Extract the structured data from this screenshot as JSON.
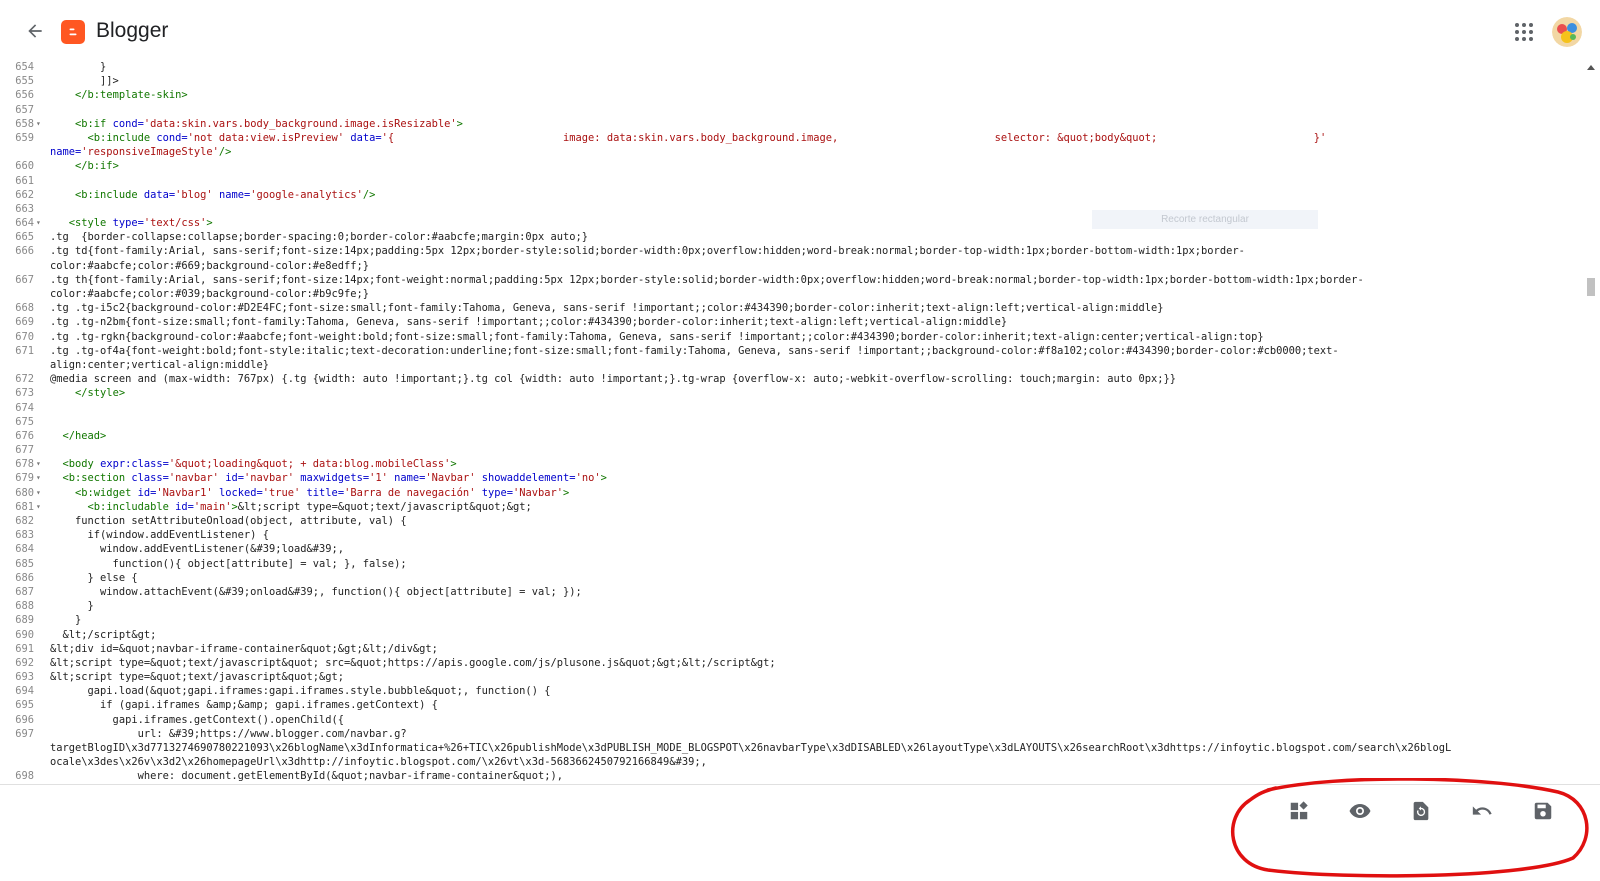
{
  "header": {
    "title": "Blogger",
    "back_icon": "arrow-left-icon",
    "apps_icon": "apps-grid-icon",
    "avatar_icon": "user-avatar"
  },
  "colors": {
    "brand": "#ff5722",
    "tag": "#117700",
    "attribute": "#0000cc",
    "string": "#aa1111",
    "annotation": "#e01010"
  },
  "editor": {
    "lines": [
      {
        "n": "654",
        "fold": "",
        "segs": [
          {
            "t": "        }"
          }
        ]
      },
      {
        "n": "655",
        "fold": "",
        "segs": [
          {
            "t": "        ]]>"
          }
        ]
      },
      {
        "n": "656",
        "fold": "",
        "segs": [
          {
            "t": "    ",
            "c": ""
          },
          {
            "t": "</b:template-skin>",
            "c": "tag"
          }
        ]
      },
      {
        "n": "657",
        "fold": "",
        "segs": [
          {
            "t": ""
          }
        ]
      },
      {
        "n": "658",
        "fold": "▾",
        "segs": [
          {
            "t": "    "
          },
          {
            "t": "<b:if ",
            "c": "tag"
          },
          {
            "t": "cond=",
            "c": "attr"
          },
          {
            "t": "'data:skin.vars.body_background.image.isResizable'",
            "c": "str"
          },
          {
            "t": ">",
            "c": "tag"
          }
        ]
      },
      {
        "n": "659",
        "fold": "",
        "segs": [
          {
            "t": "      "
          },
          {
            "t": "<b:include ",
            "c": "tag"
          },
          {
            "t": "cond=",
            "c": "attr"
          },
          {
            "t": "'not data:view.isPreview'",
            "c": "str"
          },
          {
            "t": " data=",
            "c": "attr"
          },
          {
            "t": "'{                           image: data:skin.vars.body_background.image,                         selector: &quot;body&quot;                         }'",
            "c": "str"
          }
        ]
      },
      {
        "n": "",
        "fold": "",
        "segs": [
          {
            "t": "name=",
            "c": "attr"
          },
          {
            "t": "'responsiveImageStyle'",
            "c": "str"
          },
          {
            "t": "/>",
            "c": "tag"
          }
        ]
      },
      {
        "n": "660",
        "fold": "",
        "segs": [
          {
            "t": "    "
          },
          {
            "t": "</b:if>",
            "c": "tag"
          }
        ]
      },
      {
        "n": "661",
        "fold": "",
        "segs": [
          {
            "t": ""
          }
        ]
      },
      {
        "n": "662",
        "fold": "",
        "segs": [
          {
            "t": "    "
          },
          {
            "t": "<b:include ",
            "c": "tag"
          },
          {
            "t": "data=",
            "c": "attr"
          },
          {
            "t": "'blog'",
            "c": "str"
          },
          {
            "t": " name=",
            "c": "attr"
          },
          {
            "t": "'google-analytics'",
            "c": "str"
          },
          {
            "t": "/>",
            "c": "tag"
          }
        ]
      },
      {
        "n": "663",
        "fold": "",
        "segs": [
          {
            "t": ""
          }
        ]
      },
      {
        "n": "664",
        "fold": "▾",
        "segs": [
          {
            "t": "   "
          },
          {
            "t": "<style ",
            "c": "tag"
          },
          {
            "t": "type=",
            "c": "attr"
          },
          {
            "t": "'text/css'",
            "c": "str"
          },
          {
            "t": ">",
            "c": "tag"
          }
        ]
      },
      {
        "n": "665",
        "fold": "",
        "segs": [
          {
            "t": ".tg  {border-collapse:collapse;border-spacing:0;border-color:#aabcfe;margin:0px auto;}"
          }
        ]
      },
      {
        "n": "666",
        "fold": "",
        "segs": [
          {
            "t": ".tg td{font-family:Arial, sans-serif;font-size:14px;padding:5px 12px;border-style:solid;border-width:0px;overflow:hidden;word-break:normal;border-top-width:1px;border-bottom-width:1px;border-"
          }
        ]
      },
      {
        "n": "",
        "fold": "",
        "segs": [
          {
            "t": "color:#aabcfe;color:#669;background-color:#e8edff;}"
          }
        ]
      },
      {
        "n": "667",
        "fold": "",
        "segs": [
          {
            "t": ".tg th{font-family:Arial, sans-serif;font-size:14px;font-weight:normal;padding:5px 12px;border-style:solid;border-width:0px;overflow:hidden;word-break:normal;border-top-width:1px;border-bottom-width:1px;border-"
          }
        ]
      },
      {
        "n": "",
        "fold": "",
        "segs": [
          {
            "t": "color:#aabcfe;color:#039;background-color:#b9c9fe;}"
          }
        ]
      },
      {
        "n": "668",
        "fold": "",
        "segs": [
          {
            "t": ".tg .tg-i5c2{background-color:#D2E4FC;font-size:small;font-family:Tahoma, Geneva, sans-serif !important;;color:#434390;border-color:inherit;text-align:left;vertical-align:middle}"
          }
        ]
      },
      {
        "n": "669",
        "fold": "",
        "segs": [
          {
            "t": ".tg .tg-n2bm{font-size:small;font-family:Tahoma, Geneva, sans-serif !important;;color:#434390;border-color:inherit;text-align:left;vertical-align:middle}"
          }
        ]
      },
      {
        "n": "670",
        "fold": "",
        "segs": [
          {
            "t": ".tg .tg-rgkn{background-color:#aabcfe;font-weight:bold;font-size:small;font-family:Tahoma, Geneva, sans-serif !important;;color:#434390;border-color:inherit;text-align:center;vertical-align:top}"
          }
        ]
      },
      {
        "n": "671",
        "fold": "",
        "segs": [
          {
            "t": ".tg .tg-of4a{font-weight:bold;font-style:italic;text-decoration:underline;font-size:small;font-family:Tahoma, Geneva, sans-serif !important;;background-color:#f8a102;color:#434390;border-color:#cb0000;text-"
          }
        ]
      },
      {
        "n": "",
        "fold": "",
        "segs": [
          {
            "t": "align:center;vertical-align:middle}"
          }
        ]
      },
      {
        "n": "672",
        "fold": "",
        "segs": [
          {
            "t": "@media screen and (max-width: 767px) {.tg {width: auto !important;}.tg col {width: auto !important;}.tg-wrap {overflow-x: auto;-webkit-overflow-scrolling: touch;margin: auto 0px;}}"
          }
        ]
      },
      {
        "n": "673",
        "fold": "",
        "segs": [
          {
            "t": "    "
          },
          {
            "t": "</style>",
            "c": "tag"
          }
        ]
      },
      {
        "n": "674",
        "fold": "",
        "segs": [
          {
            "t": ""
          }
        ]
      },
      {
        "n": "675",
        "fold": "",
        "segs": [
          {
            "t": ""
          }
        ]
      },
      {
        "n": "676",
        "fold": "",
        "segs": [
          {
            "t": "  "
          },
          {
            "t": "</head>",
            "c": "tag"
          }
        ]
      },
      {
        "n": "677",
        "fold": "",
        "segs": [
          {
            "t": ""
          }
        ]
      },
      {
        "n": "678",
        "fold": "▾",
        "segs": [
          {
            "t": "  "
          },
          {
            "t": "<body ",
            "c": "tag"
          },
          {
            "t": "expr:class=",
            "c": "attr"
          },
          {
            "t": "'&quot;loading&quot; + data:blog.mobileClass'",
            "c": "str"
          },
          {
            "t": ">",
            "c": "tag"
          }
        ]
      },
      {
        "n": "679",
        "fold": "▾",
        "segs": [
          {
            "t": "  "
          },
          {
            "t": "<b:section ",
            "c": "tag"
          },
          {
            "t": "class=",
            "c": "attr"
          },
          {
            "t": "'navbar'",
            "c": "str"
          },
          {
            "t": " id=",
            "c": "attr"
          },
          {
            "t": "'navbar'",
            "c": "str"
          },
          {
            "t": " maxwidgets=",
            "c": "attr"
          },
          {
            "t": "'1'",
            "c": "str"
          },
          {
            "t": " name=",
            "c": "attr"
          },
          {
            "t": "'Navbar'",
            "c": "str"
          },
          {
            "t": " showaddelement=",
            "c": "attr"
          },
          {
            "t": "'no'",
            "c": "str"
          },
          {
            "t": ">",
            "c": "tag"
          }
        ]
      },
      {
        "n": "680",
        "fold": "▾",
        "segs": [
          {
            "t": "    "
          },
          {
            "t": "<b:widget ",
            "c": "tag"
          },
          {
            "t": "id=",
            "c": "attr"
          },
          {
            "t": "'Navbar1'",
            "c": "str"
          },
          {
            "t": " locked=",
            "c": "attr"
          },
          {
            "t": "'true'",
            "c": "str"
          },
          {
            "t": " title=",
            "c": "attr"
          },
          {
            "t": "'Barra de navegación'",
            "c": "str"
          },
          {
            "t": " type=",
            "c": "attr"
          },
          {
            "t": "'Navbar'",
            "c": "str"
          },
          {
            "t": ">",
            "c": "tag"
          }
        ]
      },
      {
        "n": "681",
        "fold": "▾",
        "segs": [
          {
            "t": "      "
          },
          {
            "t": "<b:includable ",
            "c": "tag"
          },
          {
            "t": "id=",
            "c": "attr"
          },
          {
            "t": "'main'",
            "c": "str"
          },
          {
            "t": ">",
            "c": "tag"
          },
          {
            "t": "&lt;script type=&quot;text/javascript&quot;&gt;"
          }
        ]
      },
      {
        "n": "682",
        "fold": "",
        "segs": [
          {
            "t": "    function setAttributeOnload(object, attribute, val) {"
          }
        ]
      },
      {
        "n": "683",
        "fold": "",
        "segs": [
          {
            "t": "      if(window.addEventListener) {"
          }
        ]
      },
      {
        "n": "684",
        "fold": "",
        "segs": [
          {
            "t": "        window.addEventListener(&#39;load&#39;,"
          }
        ]
      },
      {
        "n": "685",
        "fold": "",
        "segs": [
          {
            "t": "          function(){ object[attribute] = val; }, false);"
          }
        ]
      },
      {
        "n": "686",
        "fold": "",
        "segs": [
          {
            "t": "      } else {"
          }
        ]
      },
      {
        "n": "687",
        "fold": "",
        "segs": [
          {
            "t": "        window.attachEvent(&#39;onload&#39;, function(){ object[attribute] = val; });"
          }
        ]
      },
      {
        "n": "688",
        "fold": "",
        "segs": [
          {
            "t": "      }"
          }
        ]
      },
      {
        "n": "689",
        "fold": "",
        "segs": [
          {
            "t": "    }"
          }
        ]
      },
      {
        "n": "690",
        "fold": "",
        "segs": [
          {
            "t": "  &lt;/script&gt;"
          }
        ]
      },
      {
        "n": "691",
        "fold": "",
        "segs": [
          {
            "t": "&lt;div id=&quot;navbar-iframe-container&quot;&gt;&lt;/div&gt;"
          }
        ]
      },
      {
        "n": "692",
        "fold": "",
        "segs": [
          {
            "t": "&lt;script type=&quot;text/javascript&quot; src=&quot;https://apis.google.com/js/plusone.js&quot;&gt;&lt;/script&gt;"
          }
        ]
      },
      {
        "n": "693",
        "fold": "",
        "segs": [
          {
            "t": "&lt;script type=&quot;text/javascript&quot;&gt;"
          }
        ]
      },
      {
        "n": "694",
        "fold": "",
        "segs": [
          {
            "t": "      gapi.load(&quot;gapi.iframes:gapi.iframes.style.bubble&quot;, function() {"
          }
        ]
      },
      {
        "n": "695",
        "fold": "",
        "segs": [
          {
            "t": "        if (gapi.iframes &amp;&amp; gapi.iframes.getContext) {"
          }
        ]
      },
      {
        "n": "696",
        "fold": "",
        "segs": [
          {
            "t": "          gapi.iframes.getContext().openChild({"
          }
        ]
      },
      {
        "n": "697",
        "fold": "",
        "segs": [
          {
            "t": "              url: &#39;https://www.blogger.com/navbar.g?"
          }
        ]
      },
      {
        "n": "",
        "fold": "",
        "segs": [
          {
            "t": "targetBlogID\\x3d7713274690780221093\\x26blogName\\x3dInformatica+%26+TIC\\x26publishMode\\x3dPUBLISH_MODE_BLOGSPOT\\x26navbarType\\x3dDISABLED\\x26layoutType\\x3dLAYOUTS\\x26searchRoot\\x3dhttps://infoytic.blogspot.com/search\\x26blogL"
          }
        ]
      },
      {
        "n": "",
        "fold": "",
        "segs": [
          {
            "t": "ocale\\x3des\\x26v\\x3d2\\x26homepageUrl\\x3dhttp://infoytic.blogspot.com/\\x26vt\\x3d-5683662450792166849&#39;,"
          }
        ]
      },
      {
        "n": "698",
        "fold": "",
        "segs": [
          {
            "t": "              where: document.getElementById(&quot;navbar-iframe-container&quot;),"
          }
        ]
      }
    ],
    "ghost_label": "Recorte rectangular"
  },
  "toolbar": {
    "buttons": [
      {
        "name": "widgets-button",
        "icon": "widgets-icon"
      },
      {
        "name": "preview-button",
        "icon": "eye-icon"
      },
      {
        "name": "restore-button",
        "icon": "restore-icon"
      },
      {
        "name": "undo-button",
        "icon": "undo-icon"
      },
      {
        "name": "save-button",
        "icon": "save-icon"
      }
    ]
  }
}
